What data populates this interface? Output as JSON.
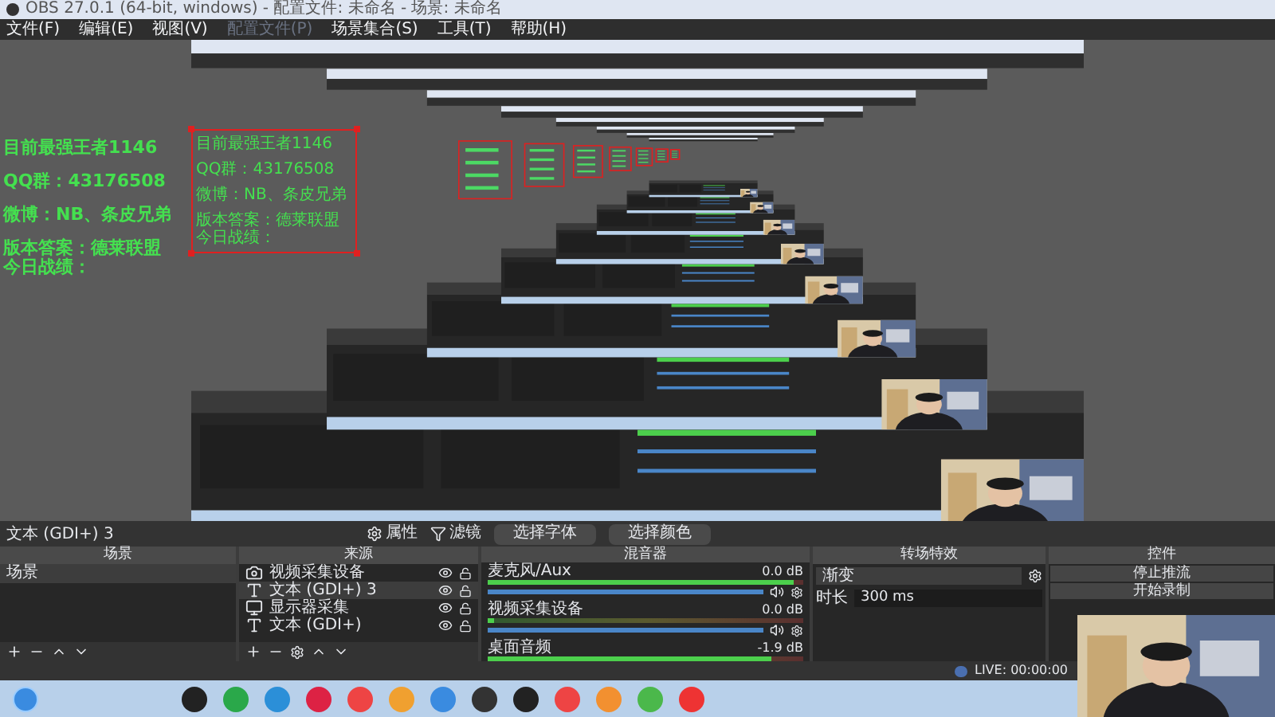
{
  "window": {
    "title": "OBS 27.0.1 (64-bit, windows) - 配置文件: 未命名 - 场景: 未命名"
  },
  "menu": [
    {
      "label": "文件(F)",
      "disabled": false
    },
    {
      "label": "编辑(E)",
      "disabled": false
    },
    {
      "label": "视图(V)",
      "disabled": false
    },
    {
      "label": "配置文件(P)",
      "disabled": true
    },
    {
      "label": "场景集合(S)",
      "disabled": false
    },
    {
      "label": "工具(T)",
      "disabled": false
    },
    {
      "label": "帮助(H)",
      "disabled": false
    }
  ],
  "preview": {
    "overlay": [
      [
        "目前最强王者1146"
      ],
      [
        "QQ群：43176508"
      ],
      [
        "微博：NB、条皮兄弟"
      ],
      [
        "版本答案：德莱联盟",
        "今日战绩："
      ]
    ],
    "nested_overlay": [
      [
        "目前最强王者1146"
      ],
      [
        "QQ群：43176508"
      ],
      [
        "微博：NB、条皮兄弟"
      ],
      [
        "版本答案：德莱联盟",
        "今日战绩："
      ]
    ]
  },
  "source_toolbar": {
    "source": "文本 (GDI+) 3",
    "buttons": [
      {
        "kind": "gear",
        "label": "属性"
      },
      {
        "kind": "filter",
        "label": "滤镜"
      },
      {
        "kind": "plain",
        "label": "选择字体"
      },
      {
        "kind": "plain",
        "label": "选择颜色"
      }
    ]
  },
  "scenes": {
    "title": "场景",
    "items": [
      {
        "name": "场景",
        "selected": true
      }
    ]
  },
  "sources": {
    "title": "来源",
    "items": [
      {
        "name": "视频采集设备",
        "kind": "camera",
        "selected": false,
        "visible": true,
        "locked": false
      },
      {
        "name": "文本 (GDI+) 3",
        "kind": "text",
        "selected": true,
        "visible": true,
        "locked": false
      },
      {
        "name": "显示器采集",
        "kind": "monitor",
        "selected": false,
        "visible": true,
        "locked": false
      },
      {
        "name": "文本 (GDI+)",
        "kind": "text",
        "selected": false,
        "visible": true,
        "locked": false
      }
    ]
  },
  "mixer": {
    "title": "混音器",
    "channels": [
      {
        "name": "麦克风/Aux",
        "reading": "0.0 dB",
        "meter": {
          "level": 0.97
        },
        "fader": {
          "level": 1
        }
      },
      {
        "name": "视频采集设备",
        "reading": "0.0 dB",
        "meter": {
          "level": 0.02
        },
        "fader": {
          "level": 1
        }
      },
      {
        "name": "桌面音频",
        "reading": "-1.9 dB",
        "meter": {
          "level": 0.9
        }
      }
    ]
  },
  "transitions": {
    "title": "转场特效",
    "selected": "渐变",
    "duration_label": "时长",
    "duration": "300 ms"
  },
  "controls": {
    "title": "控件",
    "buttons": [
      "停止推流",
      "开始录制"
    ]
  },
  "status_bar": {
    "live": "LIVE: 00:00:00"
  }
}
